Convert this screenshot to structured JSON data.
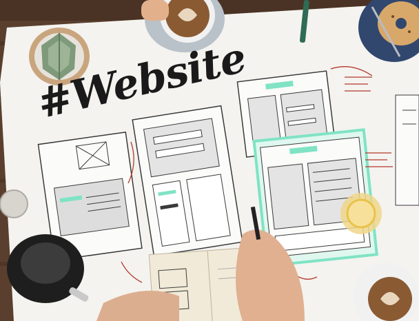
{
  "hashtag": "#Website",
  "colors": {
    "table_wood": "#5a3f2e",
    "paper": "#f4f3ef",
    "sketch_ink": "#3a3a3a",
    "mint_marker": "#7fe3c4",
    "red_notes": "#b5392f",
    "coffee": "#8a5a33"
  },
  "objects": [
    "cactus-pot",
    "coffee-cup-top",
    "coffee-cup-bottom",
    "bagel-plate",
    "tea-glass",
    "teapot",
    "notebook",
    "pen-in-hand",
    "wireframe-sheets"
  ]
}
